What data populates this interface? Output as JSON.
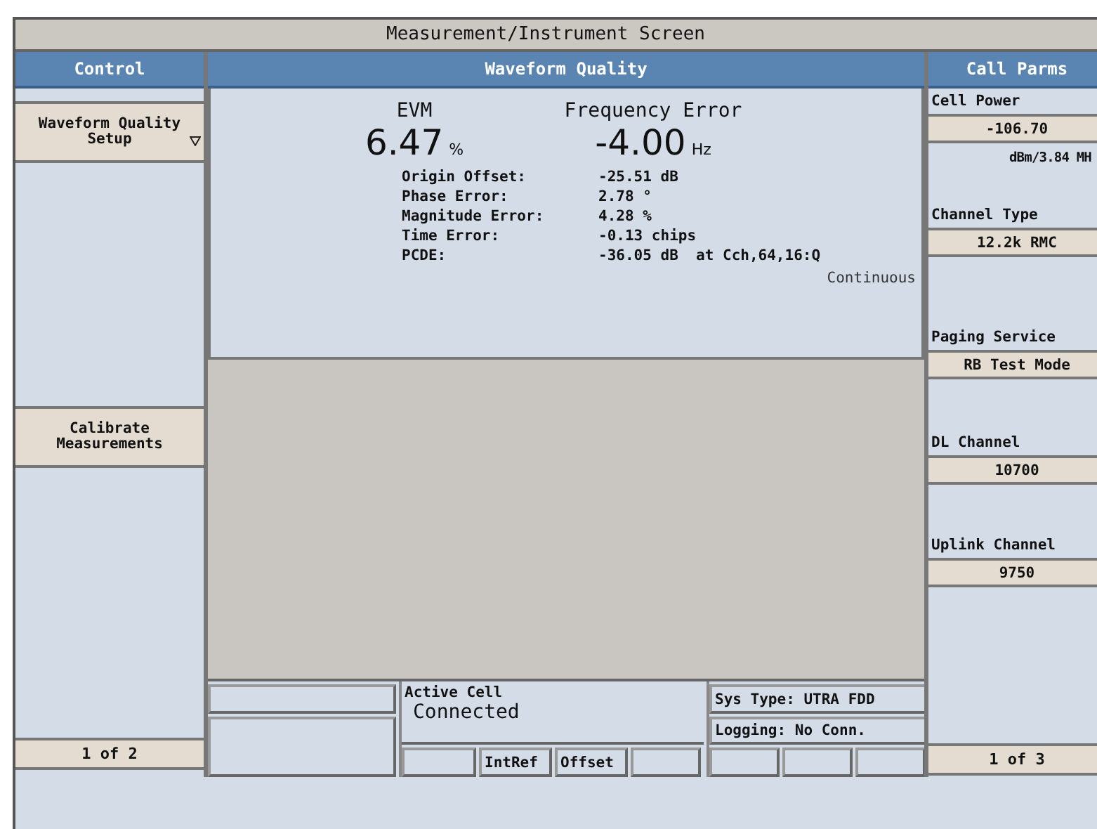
{
  "window": {
    "title": "Measurement/Instrument Screen"
  },
  "control": {
    "header": "Control",
    "buttons": [
      {
        "label": "Waveform Quality Setup",
        "menu": true
      },
      {
        "label": "Calibrate Measurements",
        "menu": false
      }
    ],
    "page": "1 of 2"
  },
  "measurement": {
    "header": "Waveform Quality",
    "primary": [
      {
        "label": "EVM",
        "value": "6.47",
        "unit": "%"
      },
      {
        "label": "Frequency Error",
        "value": "-4.00",
        "unit": "Hz"
      }
    ],
    "details": [
      {
        "label": "Origin Offset:",
        "value": "-25.51 dB"
      },
      {
        "label": "Phase Error:",
        "value": "2.78 °"
      },
      {
        "label": "Magnitude Error:",
        "value": "4.28 %"
      },
      {
        "label": "Time Error:",
        "value": "-0.13 chips"
      },
      {
        "label": "PCDE:",
        "value": "-36.05 dB  at Cch,64,16:Q"
      }
    ],
    "mode": "Continuous"
  },
  "status": {
    "active_cell_label": "Active Cell",
    "active_cell": "Connected",
    "flags": [
      "IntRef",
      "Offset"
    ],
    "sys_type": "Sys Type: UTRA FDD",
    "logging": "Logging: No Conn."
  },
  "call_parms": {
    "header": "Call Parms",
    "fields": [
      {
        "label": "Cell Power",
        "value": "-106.70",
        "unit": "dBm/3.84 MH"
      },
      {
        "label": "Channel Type",
        "value": "12.2k RMC"
      },
      {
        "label": "Paging Service",
        "value": "RB Test Mode"
      },
      {
        "label": "DL Channel",
        "value": "10700"
      },
      {
        "label": "Uplink Channel",
        "value": "9750"
      }
    ],
    "page": "1 of 3"
  }
}
